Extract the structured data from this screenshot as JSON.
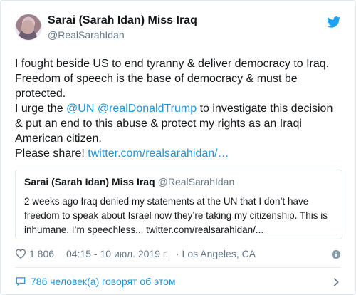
{
  "tweet": {
    "author": {
      "name": "Sarai (Sarah Idan) Miss Iraq",
      "handle": "@RealSarahIdan"
    },
    "lines": {
      "p1": "I fought beside US to end tyranny & deliver democracy to Iraq. Freedom of speech is the base of democracy & must be protected.",
      "p2_prefix": "I urge the ",
      "mention_un": "@UN",
      "mention_trump": "@realDonaldTrump",
      "p2_suffix": " to investigate this decision & put an end to this abuse & protect my rights as an Iraqi American citizen.",
      "p3_prefix": "Please share! ",
      "p3_link": "twitter.com/realsarahidan/…"
    },
    "quoted": {
      "name": "Sarai (Sarah Idan) Miss Iraq",
      "handle": "@RealSarahIdan",
      "text": "2 weeks ago Iraq denied my statements at the UN that I don’t have freedom to speak about Israel now they’re taking my citizenship. This is inhumane. I’m speechless... twitter.com/realsarahidan/..."
    },
    "meta": {
      "likes": "1 806",
      "datetime": "04:15 - 10 июл. 2019 г.",
      "location": "· Los Angeles, CA"
    },
    "footer": {
      "talking": "786 человек(а) говорят об этом"
    }
  },
  "colors": {
    "link": "#1b95e0",
    "muted": "#657786",
    "text": "#14171a",
    "border": "#e1e8ed"
  },
  "icons": {
    "brand": "twitter-bird-icon",
    "like": "heart-icon",
    "info": "info-icon",
    "reply": "comment-icon",
    "more": "chevron-right-icon"
  }
}
